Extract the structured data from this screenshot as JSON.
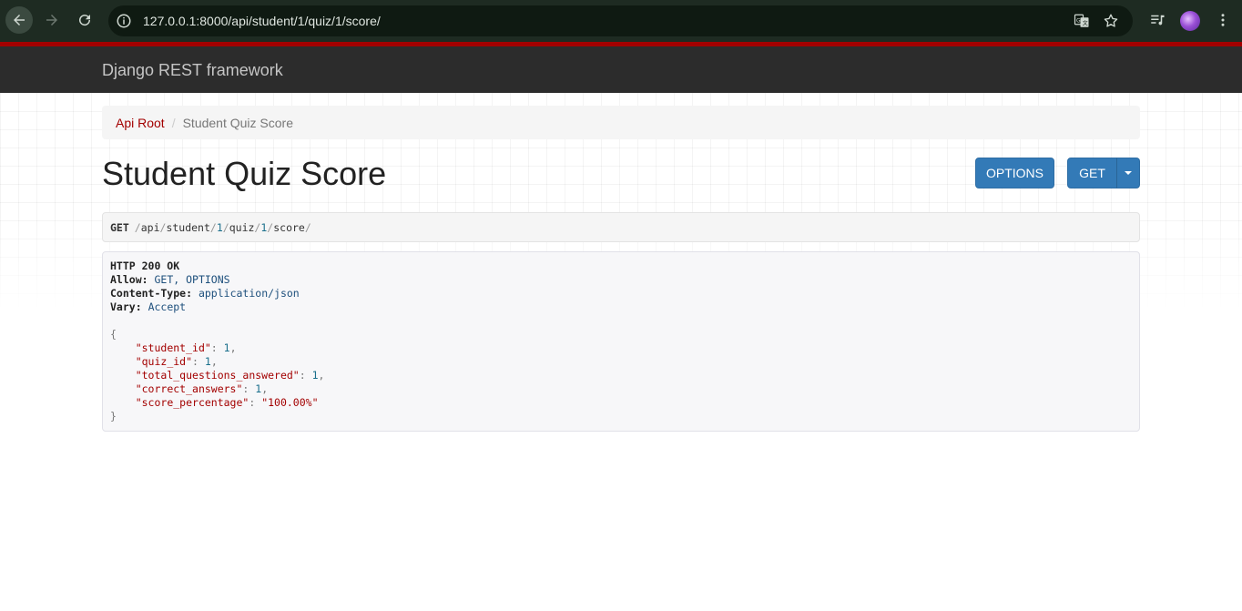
{
  "browser": {
    "url": "127.0.0.1:8000/api/student/1/quiz/1/score/"
  },
  "navbar": {
    "brand": "Django REST framework"
  },
  "breadcrumb": {
    "root": "Api Root",
    "separator": "/",
    "current": "Student Quiz Score"
  },
  "page": {
    "title": "Student Quiz Score",
    "options_button": "OPTIONS",
    "get_button": "GET"
  },
  "request": {
    "method": "GET",
    "path_parts": [
      "/",
      "api",
      "/",
      "student",
      "/",
      "1",
      "/",
      "quiz",
      "/",
      "1",
      "/",
      "score",
      "/"
    ]
  },
  "response": {
    "status": "HTTP 200 OK",
    "headers": [
      {
        "key": "Allow:",
        "value": "GET, OPTIONS"
      },
      {
        "key": "Content-Type:",
        "value": "application/json"
      },
      {
        "key": "Vary:",
        "value": "Accept"
      }
    ],
    "body_open": "{",
    "body_close": "}",
    "fields": [
      {
        "key": "\"student_id\"",
        "value": "1",
        "type": "num",
        "comma": ","
      },
      {
        "key": "\"quiz_id\"",
        "value": "1",
        "type": "num",
        "comma": ","
      },
      {
        "key": "\"total_questions_answered\"",
        "value": "1",
        "type": "num",
        "comma": ","
      },
      {
        "key": "\"correct_answers\"",
        "value": "1",
        "type": "num",
        "comma": ","
      },
      {
        "key": "\"score_percentage\"",
        "value": "\"100.00%\"",
        "type": "str",
        "comma": ""
      }
    ]
  }
}
